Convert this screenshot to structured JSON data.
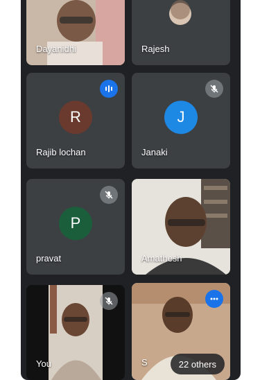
{
  "participants": [
    {
      "name": "Dayanidhi"
    },
    {
      "name": "Rajesh"
    },
    {
      "name": "Rajib lochan",
      "initial": "R",
      "color": "#6b3a2e"
    },
    {
      "name": "Janaki",
      "initial": "J",
      "color": "#1e88e5"
    },
    {
      "name": "pravat",
      "initial": "P",
      "color": "#1b5e3b"
    },
    {
      "name": "Amathesh"
    },
    {
      "name": "You"
    },
    {
      "name": "S"
    }
  ],
  "others_label": "22 others",
  "colors": {
    "background": "#202124",
    "tile": "#3c4043",
    "accent": "#1a73e8"
  }
}
